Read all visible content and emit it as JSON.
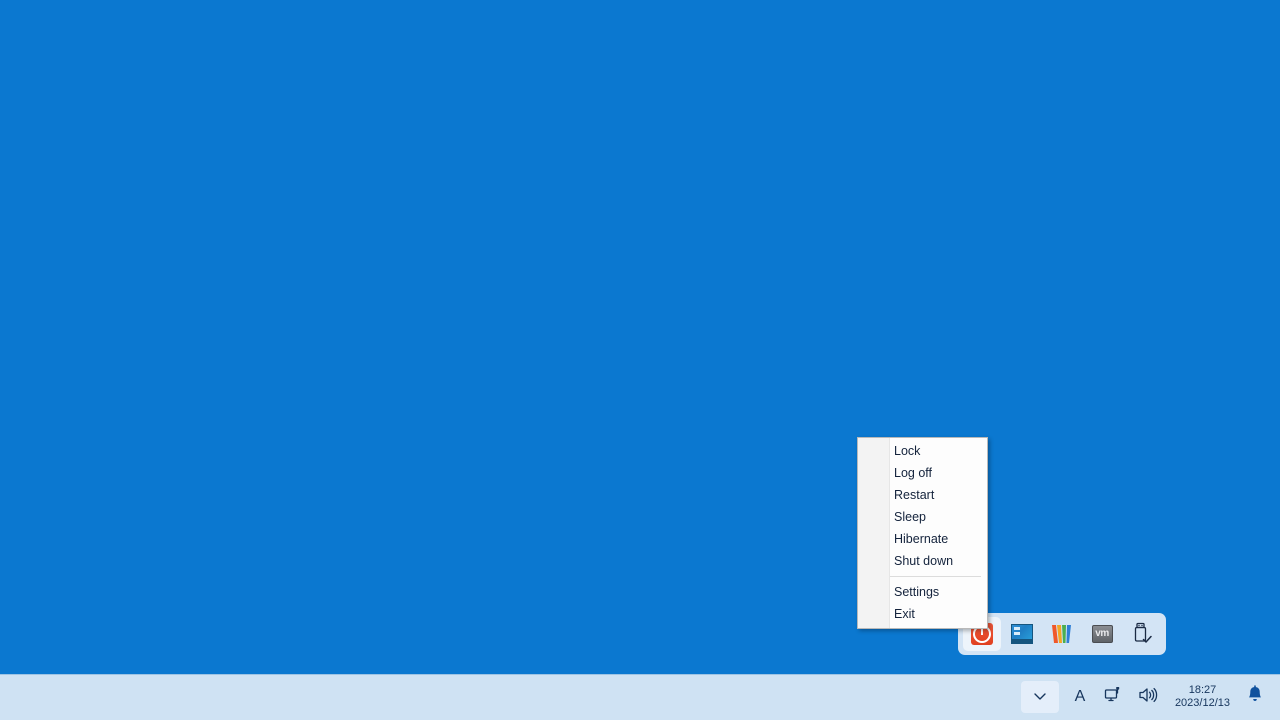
{
  "desktop": {
    "background_color": "#0b78d0"
  },
  "context_menu": {
    "name": "power-options-menu",
    "items": [
      {
        "label": "Lock",
        "type": "item",
        "name": "menu-item-lock"
      },
      {
        "label": "Log off",
        "type": "item",
        "name": "menu-item-log-off"
      },
      {
        "label": "Restart",
        "type": "item",
        "name": "menu-item-restart"
      },
      {
        "label": "Sleep",
        "type": "item",
        "name": "menu-item-sleep"
      },
      {
        "label": "Hibernate",
        "type": "item",
        "name": "menu-item-hibernate"
      },
      {
        "label": "Shut down",
        "type": "item",
        "name": "menu-item-shut-down"
      },
      {
        "type": "separator",
        "name": "menu-separator"
      },
      {
        "label": "Settings",
        "type": "item",
        "name": "menu-item-settings"
      },
      {
        "label": "Exit",
        "type": "item",
        "name": "menu-item-exit"
      }
    ]
  },
  "dock": {
    "background_color": "#d3e4f5",
    "items": [
      {
        "icon": "power-icon",
        "active": true,
        "name": "dock-item-power"
      },
      {
        "icon": "window-app-icon",
        "active": false,
        "name": "dock-item-window-app"
      },
      {
        "icon": "wondershare-w-icon",
        "active": false,
        "name": "dock-item-wondershare"
      },
      {
        "icon": "vm-icon",
        "label": "vm",
        "active": false,
        "name": "dock-item-vm"
      },
      {
        "icon": "usb-eject-icon",
        "active": false,
        "name": "dock-item-usb-eject"
      }
    ]
  },
  "taskbar": {
    "background_color": "#cfe2f3",
    "border_color": "#9ec4e4"
  },
  "tray": {
    "chevron": {
      "icon": "chevron-down-icon",
      "name": "tray-show-hidden-icons"
    },
    "ime": {
      "label": "A",
      "icon": "ime-language-icon",
      "name": "tray-ime-indicator"
    },
    "network": {
      "icon": "network-monitor-icon",
      "name": "tray-network-icon"
    },
    "volume": {
      "icon": "volume-speaker-icon",
      "name": "tray-volume-icon"
    },
    "clock": {
      "time": "18:27",
      "date": "2023/12/13",
      "name": "tray-clock"
    },
    "notifications": {
      "icon": "bell-icon",
      "name": "tray-notifications-icon"
    }
  }
}
